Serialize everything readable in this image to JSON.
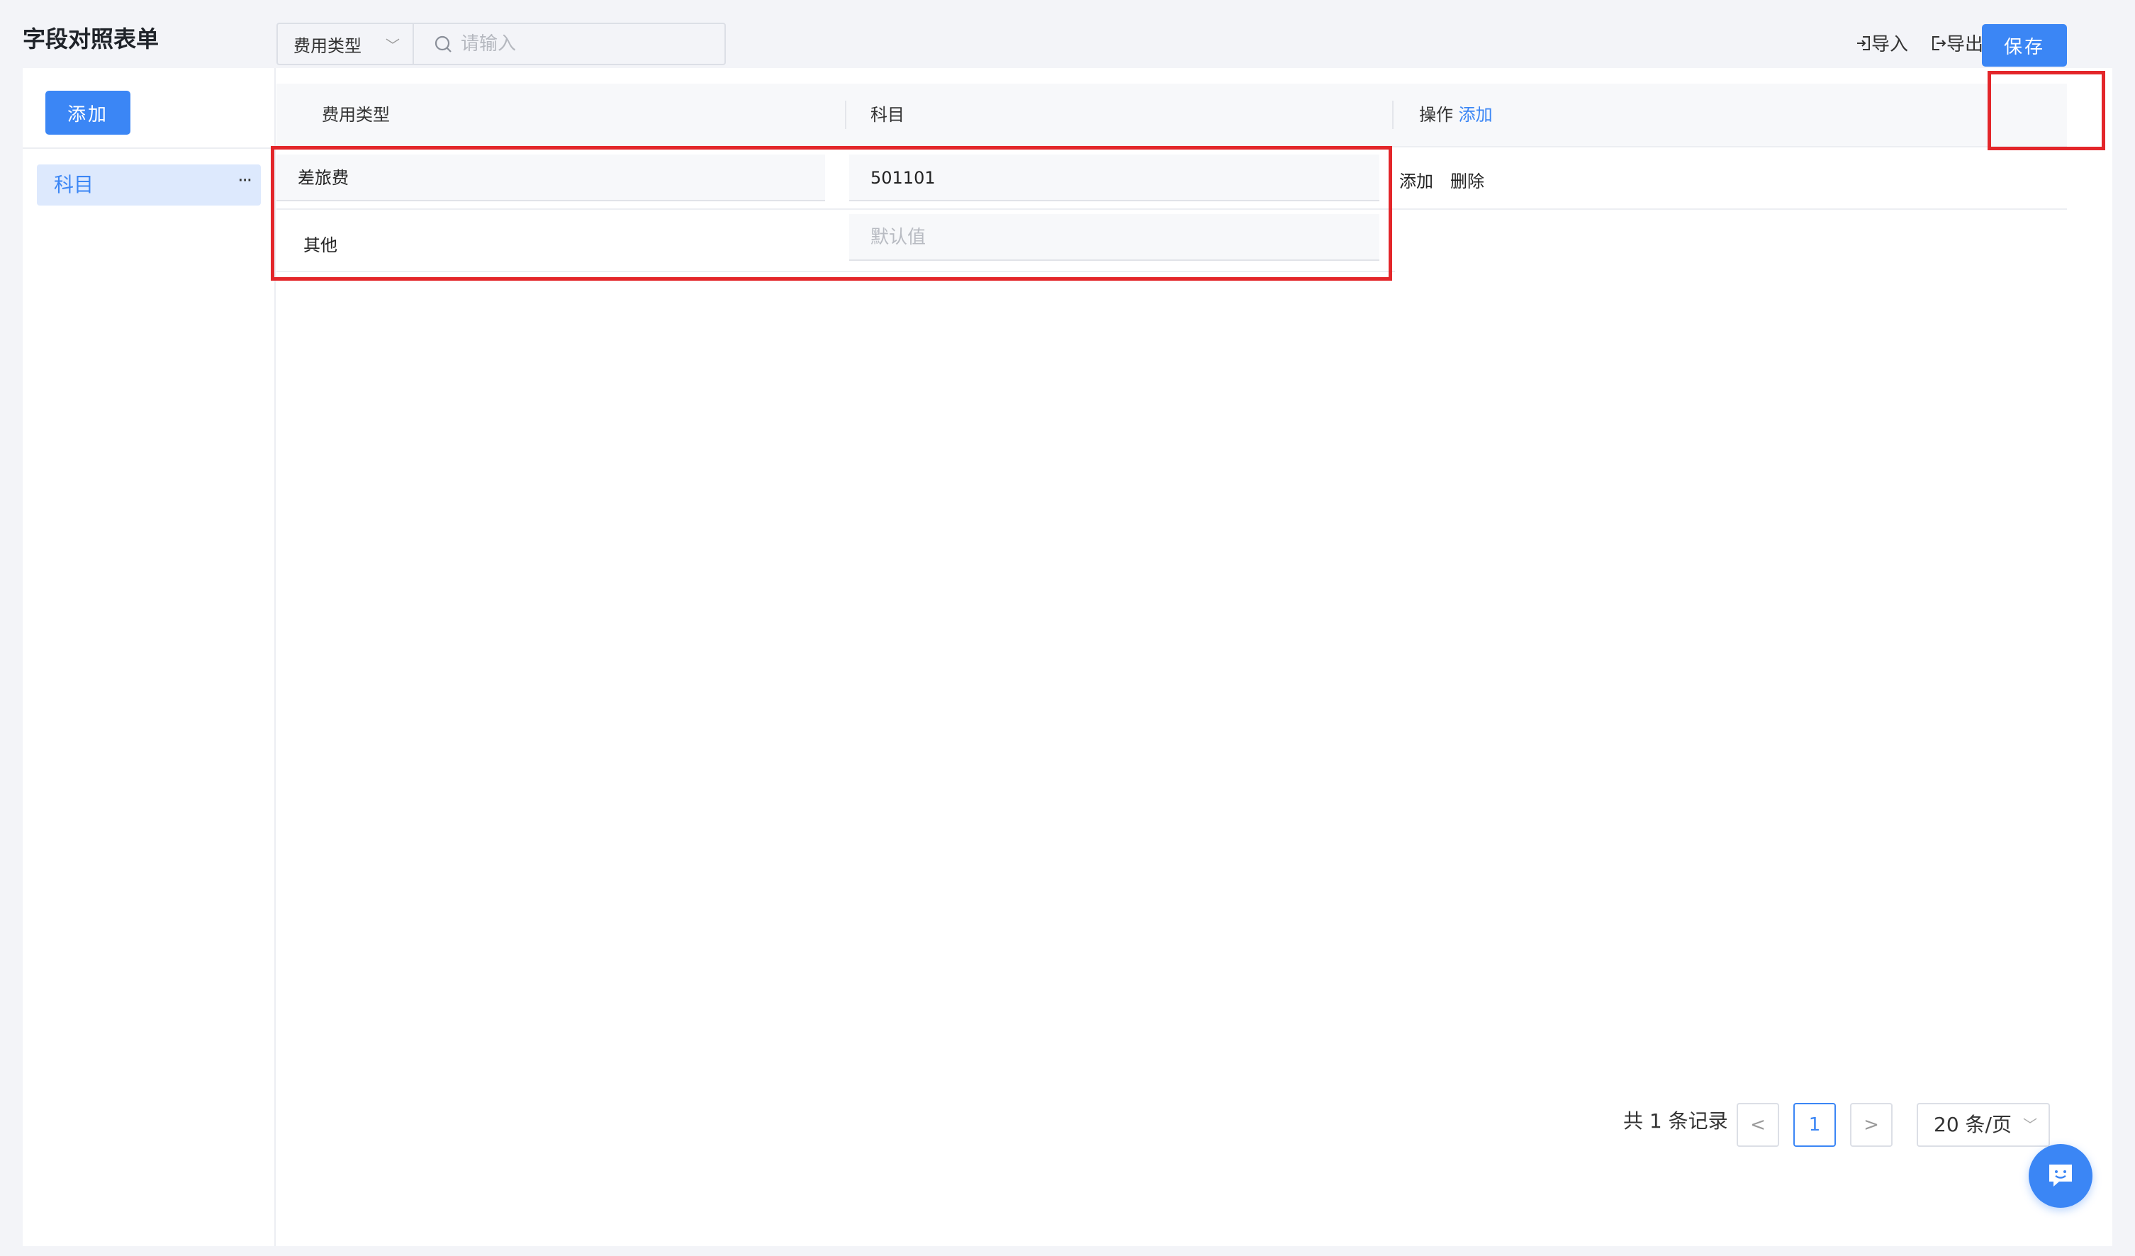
{
  "page": {
    "title": "字段对照表单"
  },
  "sidebar": {
    "add_label": "添加",
    "items": [
      {
        "label": "科目",
        "more": "···"
      }
    ]
  },
  "toolbar": {
    "filter_field": "费用类型",
    "search_placeholder": "请输入",
    "import_label": "导入",
    "export_label": "导出",
    "save_label": "保存"
  },
  "table": {
    "columns": [
      {
        "label": "费用类型"
      },
      {
        "label": "科目"
      },
      {
        "label": "操作",
        "action": "添加"
      }
    ],
    "rows": [
      {
        "expense_type": "差旅费",
        "subject": "501101",
        "actions": [
          "添加",
          "删除"
        ]
      },
      {
        "expense_type": "其他",
        "subject_placeholder": "默认值"
      }
    ]
  },
  "pagination": {
    "summary": "共 1 条记录",
    "prev": "<",
    "current": "1",
    "next": ">",
    "page_size": "20 条/页"
  },
  "colors": {
    "primary": "#3b86f5",
    "highlight": "#e3262a"
  }
}
